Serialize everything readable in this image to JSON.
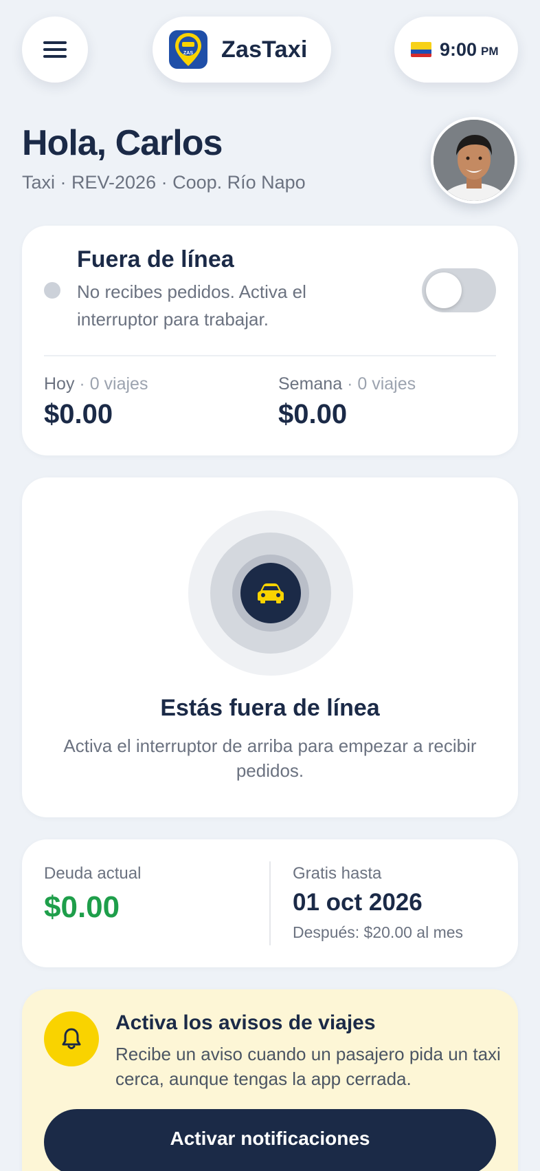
{
  "header": {
    "brand_name": "ZasTaxi",
    "logo_text": "ZAS",
    "time": "9:00",
    "ampm": "PM",
    "country_flag": "ecuador-flag"
  },
  "profile": {
    "greeting": "Hola, Carlos",
    "subline": "Taxi · REV-2026 · Coop. Río Napo"
  },
  "status": {
    "title": "Fuera de línea",
    "description": "No recibes pedidos. Activa el interruptor para trabajar.",
    "online": false
  },
  "earnings": {
    "today_label": "Hoy",
    "today_trips": "· 0 viajes",
    "today_value": "$0.00",
    "week_label": "Semana",
    "week_trips": "· 0 viajes",
    "week_value": "$0.00"
  },
  "offline": {
    "title": "Estás fuera de línea",
    "description": "Activa el interruptor de arriba para empezar a recibir pedidos."
  },
  "billing": {
    "debt_label": "Deuda actual",
    "debt_value": "$0.00",
    "free_label": "Gratis hasta",
    "free_date": "01 oct 2026",
    "after_text": "Después: $20.00 al mes"
  },
  "notifications": {
    "title": "Activa los avisos de viajes",
    "description": "Recibe un aviso cuando un pasajero pida un taxi cerca, aunque tengas la app cerrada.",
    "button_label": "Activar notificaciones"
  },
  "colors": {
    "navy": "#1b2a47",
    "accent_yellow": "#f9d300",
    "success_green": "#1e9e4a",
    "notify_bg": "#fdf6d6"
  },
  "icons": {
    "menu": "menu-icon",
    "car": "car-icon",
    "bell": "bell-icon"
  }
}
